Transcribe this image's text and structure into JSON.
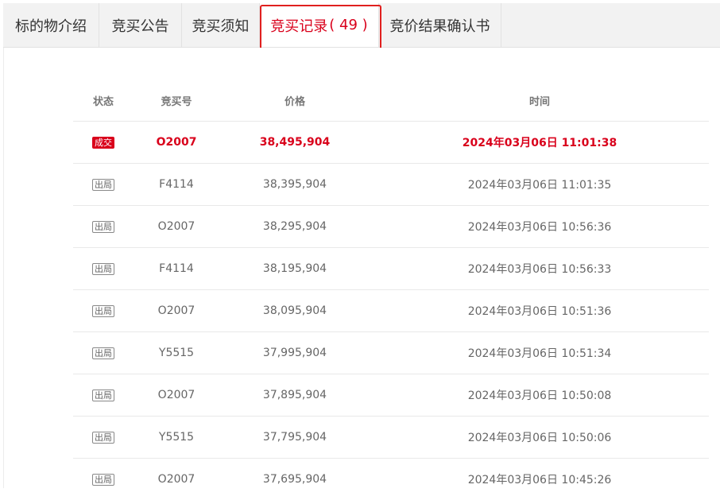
{
  "tabs": [
    {
      "label": "标的物介绍"
    },
    {
      "label": "竞买公告"
    },
    {
      "label": "竞买须知"
    },
    {
      "label": "竞买记录",
      "count": "( 49 )"
    },
    {
      "label": "竞价结果确认书"
    }
  ],
  "table": {
    "headers": {
      "status": "状态",
      "bid_no": "竞买号",
      "price": "价格",
      "time": "时间"
    },
    "rows": [
      {
        "status": "成交",
        "bid_no": "O2007",
        "price": "38,495,904",
        "time": "2024年03月06日 11:01:38"
      },
      {
        "status": "出局",
        "bid_no": "F4114",
        "price": "38,395,904",
        "time": "2024年03月06日 11:01:35"
      },
      {
        "status": "出局",
        "bid_no": "O2007",
        "price": "38,295,904",
        "time": "2024年03月06日 10:56:36"
      },
      {
        "status": "出局",
        "bid_no": "F4114",
        "price": "38,195,904",
        "time": "2024年03月06日 10:56:33"
      },
      {
        "status": "出局",
        "bid_no": "O2007",
        "price": "38,095,904",
        "time": "2024年03月06日 10:51:36"
      },
      {
        "status": "出局",
        "bid_no": "Y5515",
        "price": "37,995,904",
        "time": "2024年03月06日 10:51:34"
      },
      {
        "status": "出局",
        "bid_no": "O2007",
        "price": "37,895,904",
        "time": "2024年03月06日 10:50:08"
      },
      {
        "status": "出局",
        "bid_no": "Y5515",
        "price": "37,795,904",
        "time": "2024年03月06日 10:50:06"
      },
      {
        "status": "出局",
        "bid_no": "O2007",
        "price": "37,695,904",
        "time": "2024年03月06日 10:45:26"
      }
    ]
  },
  "colors": {
    "accent": "#d9001b",
    "tab_bg": "#f2f2f2"
  }
}
